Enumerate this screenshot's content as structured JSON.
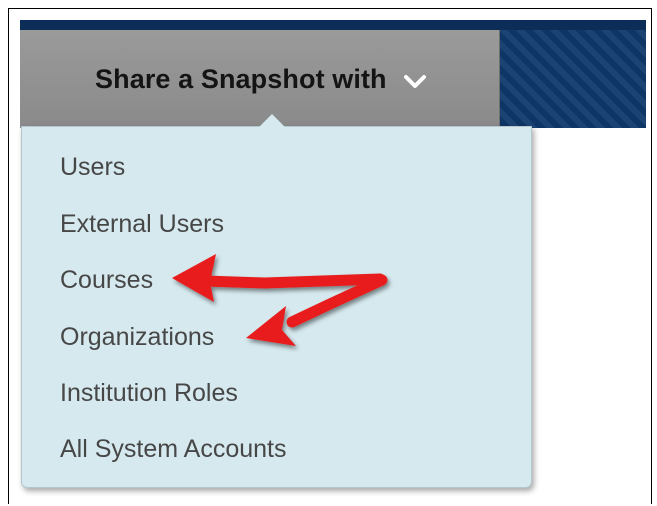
{
  "header": {
    "share_label": "Share a Snapshot with",
    "chevron_icon": "chevron-down-icon",
    "bar_color": "#0f3a6e"
  },
  "menu": {
    "items": [
      {
        "label": "Users"
      },
      {
        "label": "External Users"
      },
      {
        "label": "Courses"
      },
      {
        "label": "Organizations"
      },
      {
        "label": "Institution Roles"
      },
      {
        "label": "All System Accounts"
      }
    ],
    "background": "#d5e9ee"
  },
  "annotations": {
    "arrow_color": "#e81c1c",
    "arrow_icon": "annotation-arrow",
    "targets": [
      "Courses",
      "Organizations"
    ]
  }
}
